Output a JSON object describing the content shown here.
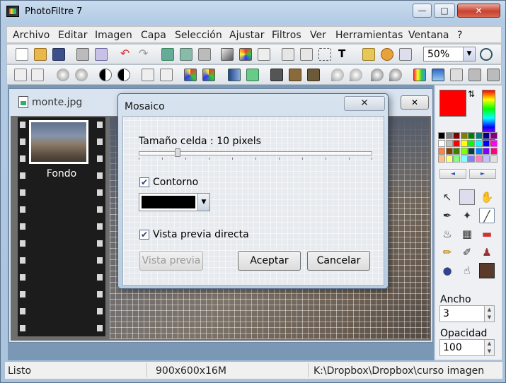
{
  "window": {
    "title": "PhotoFiltre 7",
    "minimize": "—",
    "maximize": "□",
    "close": "✕"
  },
  "menu": [
    "Archivo",
    "Editar",
    "Imagen",
    "Capa",
    "Selección",
    "Ajustar",
    "Filtros",
    "Ver",
    "Herramientas",
    "Ventana",
    "?"
  ],
  "toolbar": {
    "zoom": "50%",
    "zoom_arrow": "▼",
    "tool_text": "T"
  },
  "document": {
    "title": "monte.jpg",
    "close": "✕",
    "layer_name": "Fondo"
  },
  "palette": {
    "foreground": "#ff0000",
    "background": "#ffffff",
    "swap": "⇅",
    "prev": "◄",
    "next": "►",
    "colors": [
      "#000000",
      "#7f7f7f",
      "#800000",
      "#808000",
      "#008000",
      "#008080",
      "#000080",
      "#800080",
      "#ffffff",
      "#c0c0c0",
      "#ff0000",
      "#ffff00",
      "#00ff00",
      "#00ffff",
      "#0000ff",
      "#ff00ff",
      "#ff8040",
      "#804000",
      "#408000",
      "#80ff00",
      "#004040",
      "#0080ff",
      "#8000ff",
      "#ff0080",
      "#ffc080",
      "#ffff80",
      "#80ff80",
      "#80ffff",
      "#8080ff",
      "#ff80c0",
      "#c0c0ff",
      "#e0e0e0"
    ]
  },
  "properties": {
    "ancho_label": "Ancho",
    "ancho_value": "3",
    "opacidad_label": "Opacidad",
    "opacidad_value": "100",
    "spin_up": "▲",
    "spin_down": "▼"
  },
  "dialog": {
    "title": "Mosaico",
    "close": "✕",
    "cell_label": "Tamaño celda : 10 pixels",
    "cell_size": 10,
    "contorno_label": "Contorno",
    "contorno_checked": true,
    "contorno_color": "#000000",
    "check": "✔",
    "combo_arrow": "▼",
    "vista_label": "Vista previa directa",
    "vista_checked": true,
    "btn_preview": "Vista previa",
    "btn_accept": "Aceptar",
    "btn_cancel": "Cancelar"
  },
  "status": {
    "state": "Listo",
    "size": "900x600x16M",
    "path": "K:\\Dropbox\\Dropbox\\curso imagen"
  }
}
